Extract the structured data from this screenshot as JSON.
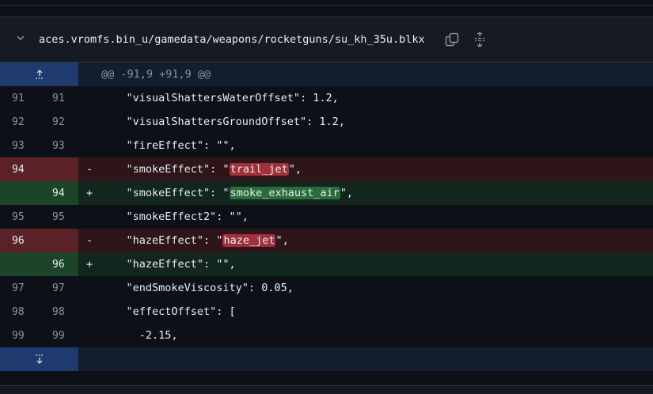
{
  "file": {
    "path": "aces.vromfs.bin_u/gamedata/weapons/rocketguns/su_kh_35u.blkx",
    "icons": {
      "collapse": "chevron-down-icon",
      "copy": "copy-icon",
      "expand": "unfold-icon"
    }
  },
  "hunk_header": "@@ -91,9 +91,9 @@",
  "lines": [
    {
      "type": "ctx",
      "old": "91",
      "new": "91",
      "sign": "",
      "pre": "    \"visualShattersWaterOffset\": 1.2,",
      "hl": "",
      "post": ""
    },
    {
      "type": "ctx",
      "old": "92",
      "new": "92",
      "sign": "",
      "pre": "    \"visualShattersGroundOffset\": 1.2,",
      "hl": "",
      "post": ""
    },
    {
      "type": "ctx",
      "old": "93",
      "new": "93",
      "sign": "",
      "pre": "    \"fireEffect\": \"\",",
      "hl": "",
      "post": ""
    },
    {
      "type": "del",
      "old": "94",
      "new": "",
      "sign": "-",
      "pre": "    \"smokeEffect\": \"",
      "hl": "trail_jet",
      "post": "\","
    },
    {
      "type": "add",
      "old": "",
      "new": "94",
      "sign": "+",
      "pre": "    \"smokeEffect\": \"",
      "hl": "smoke_exhaust_air",
      "post": "\","
    },
    {
      "type": "ctx",
      "old": "95",
      "new": "95",
      "sign": "",
      "pre": "    \"smokeEffect2\": \"\",",
      "hl": "",
      "post": ""
    },
    {
      "type": "del",
      "old": "96",
      "new": "",
      "sign": "-",
      "pre": "    \"hazeEffect\": \"",
      "hl": "haze_jet",
      "post": "\","
    },
    {
      "type": "add",
      "old": "",
      "new": "96",
      "sign": "+",
      "pre": "    \"hazeEffect\": \"\",",
      "hl": "",
      "post": ""
    },
    {
      "type": "ctx",
      "old": "97",
      "new": "97",
      "sign": "",
      "pre": "    \"endSmokeViscosity\": 0.05,",
      "hl": "",
      "post": ""
    },
    {
      "type": "ctx",
      "old": "98",
      "new": "98",
      "sign": "",
      "pre": "    \"effectOffset\": [",
      "hl": "",
      "post": ""
    },
    {
      "type": "ctx",
      "old": "99",
      "new": "99",
      "sign": "",
      "pre": "      -2.15,",
      "hl": "",
      "post": ""
    }
  ],
  "colors": {
    "deletion_line": "#2d1519",
    "addition_line": "#12261e",
    "deletion_highlight": "#a0303a",
    "addition_highlight": "#2b6c3c",
    "hunk_gutter": "#1f3a6e"
  }
}
